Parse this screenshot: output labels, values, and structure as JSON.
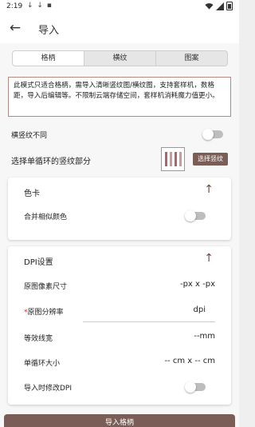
{
  "status_bar": {
    "time": "2:19",
    "notifications": "↓ ↓ ▪"
  },
  "app_bar": {
    "back_icon": "arrow-left-icon",
    "title": "导入"
  },
  "tabs": [
    {
      "label": "格柄",
      "active": true
    },
    {
      "label": "横纹",
      "active": false
    },
    {
      "label": "图案",
      "active": false
    }
  ],
  "notice_text": "此模式只适合格柄，需导入清晰竖纹图/横纹图，支持套样机，数格距，导入后编辑等。不限制云端存储空间，套样机消耗魔力值更小。",
  "different_stripes": {
    "label": "横竖纹不同",
    "on": false
  },
  "select_section": {
    "label": "选择单循环的竖纹部分",
    "button": "选择竖纹"
  },
  "color_card": {
    "title": "色卡",
    "merge_label": "合并相似颜色",
    "merge_on": false
  },
  "dpi": {
    "title": "DPI设置",
    "rows": [
      {
        "label": "原图像素尺寸",
        "value": "-px x -px",
        "required": false
      },
      {
        "label": "原图分辨率",
        "value": "dpi",
        "required": true
      },
      {
        "label": "等效线宽",
        "value": "--mm",
        "required": false
      },
      {
        "label": "单循环大小",
        "value": "-- cm x -- cm",
        "required": false
      }
    ],
    "modify_label": "导入时修改DPI",
    "modify_on": false
  },
  "import_button": "导入格柄",
  "colors": {
    "accent": "#7a5d57",
    "notice_border": "#b78a80"
  }
}
